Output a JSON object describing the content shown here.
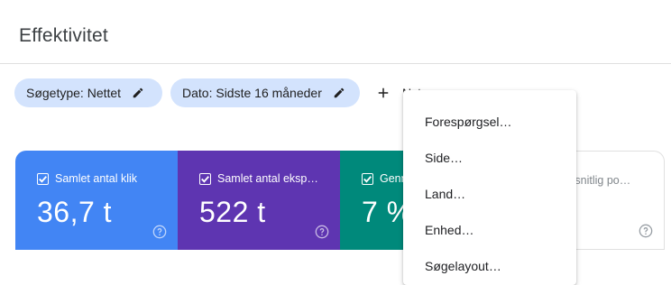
{
  "page": {
    "title": "Effektivitet"
  },
  "filters": {
    "search_type": "Søgetype: Nettet",
    "date": "Dato: Sidste 16 måneder",
    "new_label": "Nyt"
  },
  "metrics": [
    {
      "label": "Samlet antal klik",
      "value": "36,7 t",
      "checked": true,
      "color": "#4285f4"
    },
    {
      "label": "Samlet antal eksp…",
      "value": "522 t",
      "checked": true,
      "color": "#5e35b1"
    },
    {
      "label": "Genn",
      "value": "7 %",
      "checked": true,
      "color": "#00897b"
    },
    {
      "label": "msnitlig po…",
      "value": "",
      "checked": false
    }
  ],
  "menu": {
    "items": [
      "Forespørgsel…",
      "Side…",
      "Land…",
      "Enhed…",
      "Søgelayout…"
    ]
  }
}
